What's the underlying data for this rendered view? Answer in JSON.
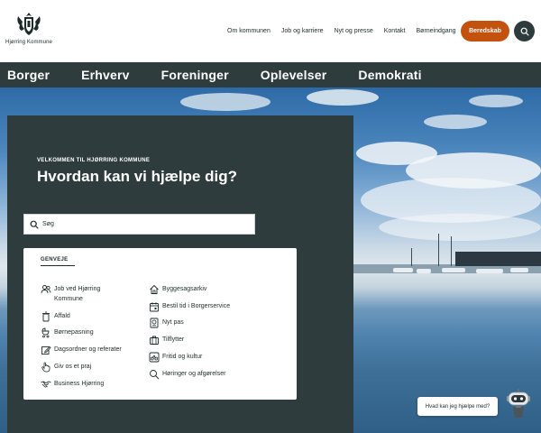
{
  "header": {
    "logo_text": "Hjørring Kommune",
    "top_links": [
      "Om kommunen",
      "Job og karriere",
      "Nyt og presse",
      "Kontakt",
      "Børneindgang"
    ],
    "beredskab_label": "Beredskab",
    "search_icon": "search-icon",
    "accent_color": "#c4520f",
    "dark_color": "#2f3c3d"
  },
  "mainnav": {
    "items": [
      "Borger",
      "Erhverv",
      "Foreninger",
      "Oplevelser",
      "Demokrati"
    ]
  },
  "hero": {
    "eyebrow": "VELKOMMEN TIL HJØRRING KOMMUNE",
    "headline": "Hvordan kan vi hjælpe dig?",
    "search_placeholder": "Søg"
  },
  "shortcuts": {
    "title": "GENVEJE",
    "left": [
      {
        "label": "Job ved Hjørring Kommune",
        "icon": "people-icon"
      },
      {
        "label": "Affald",
        "icon": "trash-icon"
      },
      {
        "label": "Børnepasning",
        "icon": "stroller-icon"
      },
      {
        "label": "Dagsordner og referater",
        "icon": "edit-icon"
      },
      {
        "label": "Giv os et praj",
        "icon": "hand-icon"
      },
      {
        "label": "Business Hjørring",
        "icon": "handshake-icon"
      }
    ],
    "right": [
      {
        "label": "Byggesagsarkiv",
        "icon": "house-icon"
      },
      {
        "label": "Bestil tid i Borgerservice",
        "icon": "calendar-icon"
      },
      {
        "label": "Nyt pas",
        "icon": "passport-icon"
      },
      {
        "label": "Tilflytter",
        "icon": "suitcase-icon"
      },
      {
        "label": "Fritid og kultur",
        "icon": "bike-icon"
      },
      {
        "label": "Høringer og afgørelser",
        "icon": "magnifier-icon"
      }
    ]
  },
  "chat": {
    "bubble_text": "Hvad kan jeg hjælpe med?",
    "icon": "robot-icon"
  }
}
